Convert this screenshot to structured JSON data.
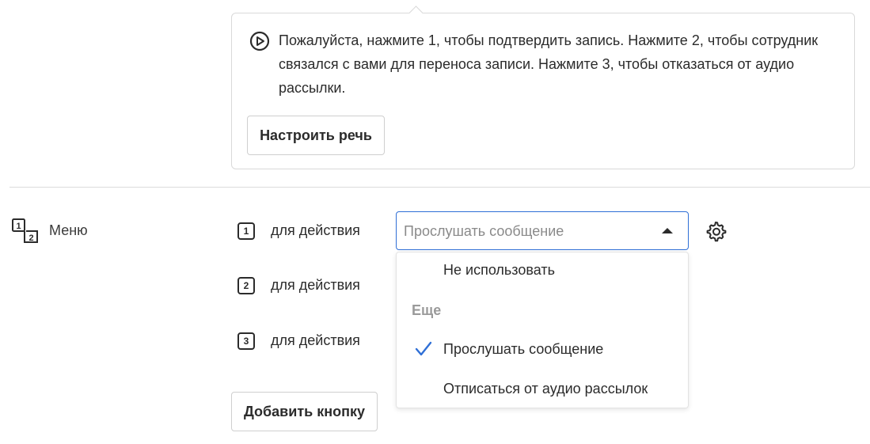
{
  "speech": {
    "text": "Пожалуйста, нажмите 1, чтобы подтвердить запись. Нажмите 2, чтобы сотрудник связался с вами для переноса записи. Нажмите 3, чтобы отказаться от аудио рассылки.",
    "tune_button": "Настроить речь"
  },
  "menu": {
    "label": "Меню",
    "rows": [
      {
        "key": "1",
        "text": "для действия"
      },
      {
        "key": "2",
        "text": "для действия"
      },
      {
        "key": "3",
        "text": "для действия"
      }
    ],
    "select": {
      "placeholder": "Прослушать сообщение"
    },
    "dropdown": {
      "option_none": "Не использовать",
      "group_label": "Еще",
      "option_listen": "Прослушать сообщение",
      "option_unsubscribe": "Отписаться от аудио рассылок",
      "selected": "Прослушать сообщение"
    },
    "add_button": "Добавить кнопку"
  },
  "colors": {
    "accent": "#2f6fd6",
    "border": "#d9d9d9",
    "text": "#2b2b2b",
    "muted": "#9a9a9a"
  },
  "icons": {
    "play": "play-circle-icon",
    "menu": "numbered-keys-icon",
    "gear": "gear-icon",
    "check": "check-icon"
  }
}
